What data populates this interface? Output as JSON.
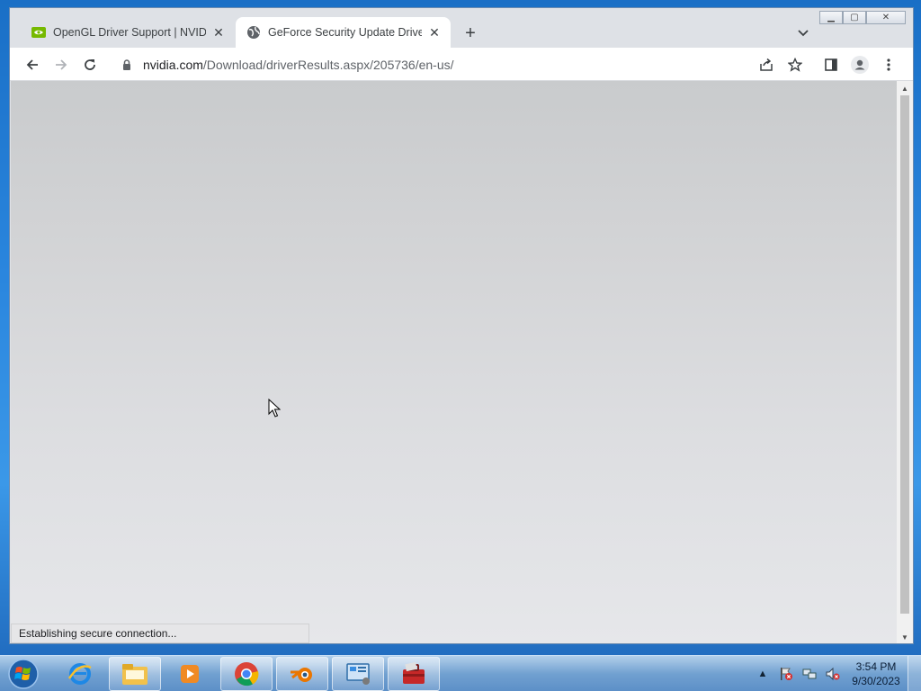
{
  "browser": {
    "tabs": [
      {
        "title": "OpenGL Driver Support | NVIDIA",
        "active": false,
        "favicon": "nvidia-icon"
      },
      {
        "title": "GeForce Security Update Driver |",
        "active": true,
        "favicon": "globe-icon"
      }
    ],
    "new_tab_label": "+",
    "close_glyph": "✕",
    "address": {
      "host": "nvidia.com",
      "path": "/Download/driverResults.aspx/205736/en-us/"
    },
    "status_text": "Establishing secure connection..."
  },
  "window_caption": {
    "minimize": "▁",
    "maximize": "▢",
    "close": "✕"
  },
  "taskbar": {
    "apps": [
      "internet-explorer-icon",
      "file-explorer-icon",
      "media-player-icon",
      "chrome-icon",
      "blender-icon",
      "control-panel-icon",
      "toolbox-icon"
    ],
    "clock_time": "3:54 PM",
    "clock_date": "9/30/2023",
    "tray_arrow": "▲"
  },
  "colors": {
    "accent": "#1a73e8",
    "nvidia_green": "#76b900",
    "content_bg_top": "#c9cbcd",
    "content_bg_bottom": "#e6e7ea"
  }
}
